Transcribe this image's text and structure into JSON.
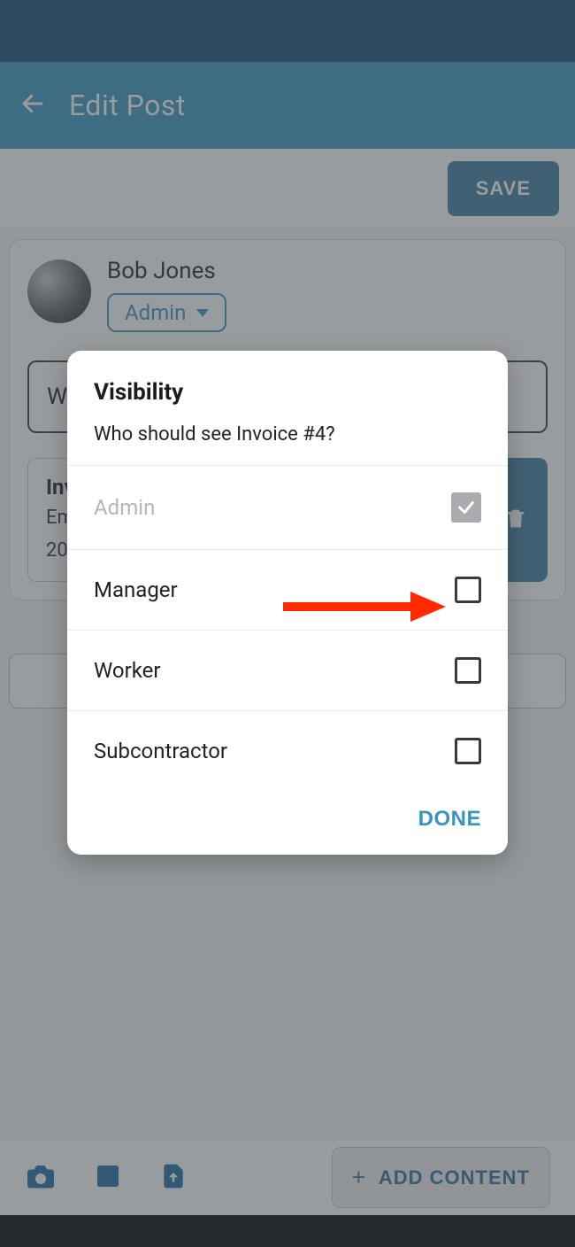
{
  "appbar": {
    "title": "Edit Post"
  },
  "save": {
    "label": "SAVE"
  },
  "author": {
    "name": "Bob Jones",
    "role": "Admin"
  },
  "post": {
    "body_prefix": "W",
    "attachment": {
      "title_prefix": "Inv",
      "line1_prefix": "Em",
      "line2_prefix": "20"
    }
  },
  "dialog": {
    "title": "Visibility",
    "subtitle": "Who should see Invoice #4?",
    "options": [
      {
        "label": "Admin",
        "locked": true,
        "checked": true
      },
      {
        "label": "Manager",
        "locked": false,
        "checked": false
      },
      {
        "label": "Worker",
        "locked": false,
        "checked": false
      },
      {
        "label": "Subcontractor",
        "locked": false,
        "checked": false
      }
    ],
    "done": "DONE"
  },
  "bottom": {
    "add_content": "ADD CONTENT"
  }
}
